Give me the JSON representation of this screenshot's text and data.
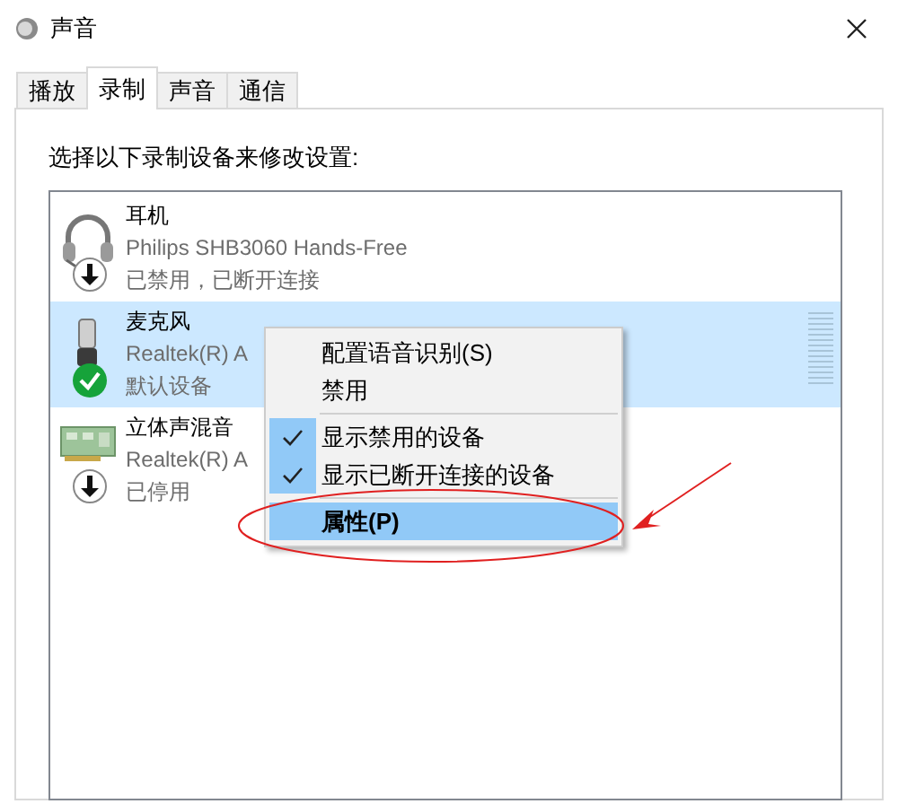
{
  "window": {
    "title": "声音"
  },
  "tabs": [
    {
      "label": "播放",
      "selected": false
    },
    {
      "label": "录制",
      "selected": true
    },
    {
      "label": "声音",
      "selected": false
    },
    {
      "label": "通信",
      "selected": false
    }
  ],
  "instruction": "选择以下录制设备来修改设置:",
  "devices": [
    {
      "name": "耳机",
      "driver": "Philips SHB3060 Hands-Free",
      "status": "已禁用，已断开连接",
      "kind": "headset",
      "default": false,
      "selected": false
    },
    {
      "name": "麦克风",
      "driver": "Realtek(R) A",
      "status": "默认设备",
      "kind": "microphone",
      "default": true,
      "selected": true
    },
    {
      "name": "立体声混音",
      "driver": "Realtek(R) A",
      "status": "已停用",
      "kind": "board",
      "default": false,
      "selected": false
    }
  ],
  "context_menu": {
    "items": [
      {
        "kind": "item",
        "label": "配置语音识别(S)",
        "checked": false,
        "selected": false
      },
      {
        "kind": "item",
        "label": "禁用",
        "checked": false,
        "selected": false
      },
      {
        "kind": "separator"
      },
      {
        "kind": "item",
        "label": "显示禁用的设备",
        "checked": true,
        "selected": false
      },
      {
        "kind": "item",
        "label": "显示已断开连接的设备",
        "checked": true,
        "selected": false
      },
      {
        "kind": "separator"
      },
      {
        "kind": "item",
        "label": "属性(P)",
        "checked": false,
        "selected": true
      }
    ]
  }
}
